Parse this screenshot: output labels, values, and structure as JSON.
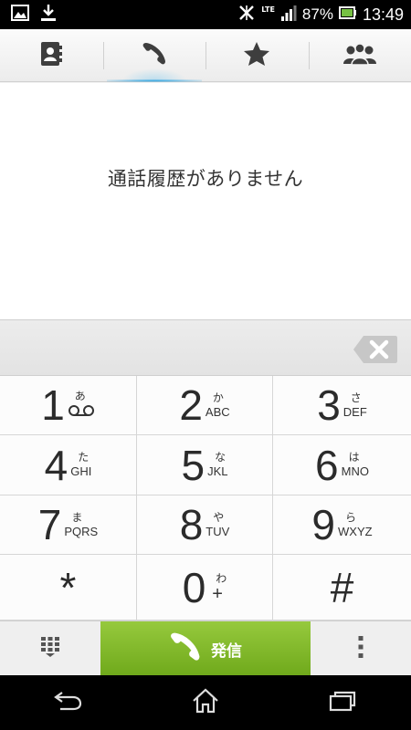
{
  "status_bar": {
    "network": "LTE",
    "battery": "87%",
    "time": "13:49",
    "icons": [
      "gallery-icon",
      "download-icon",
      "no-sync-icon",
      "signal-icon",
      "battery-icon"
    ]
  },
  "tabs": [
    {
      "name": "contacts",
      "icon": "contacts-book-icon",
      "active": false
    },
    {
      "name": "call-log",
      "icon": "phone-handset-icon",
      "active": true
    },
    {
      "name": "favorites",
      "icon": "star-icon",
      "active": false
    },
    {
      "name": "groups",
      "icon": "group-people-icon",
      "active": false
    }
  ],
  "content": {
    "empty_message": "通話履歴がありません"
  },
  "keypad": {
    "keys": [
      {
        "num": "1",
        "kana": "あ",
        "letters": "voicemail-icon"
      },
      {
        "num": "2",
        "kana": "か",
        "letters": "ABC"
      },
      {
        "num": "3",
        "kana": "さ",
        "letters": "DEF"
      },
      {
        "num": "4",
        "kana": "た",
        "letters": "GHI"
      },
      {
        "num": "5",
        "kana": "な",
        "letters": "JKL"
      },
      {
        "num": "6",
        "kana": "は",
        "letters": "MNO"
      },
      {
        "num": "7",
        "kana": "ま",
        "letters": "PQRS"
      },
      {
        "num": "8",
        "kana": "や",
        "letters": "TUV"
      },
      {
        "num": "9",
        "kana": "ら",
        "letters": "WXYZ"
      },
      {
        "num": "*",
        "kana": "",
        "letters": ""
      },
      {
        "num": "0",
        "kana": "わ",
        "letters": "+"
      },
      {
        "num": "#",
        "kana": "",
        "letters": ""
      }
    ]
  },
  "actions": {
    "call_label": "発信"
  },
  "colors": {
    "call_green": "#7fb82b",
    "tab_highlight": "#39a7e0"
  }
}
